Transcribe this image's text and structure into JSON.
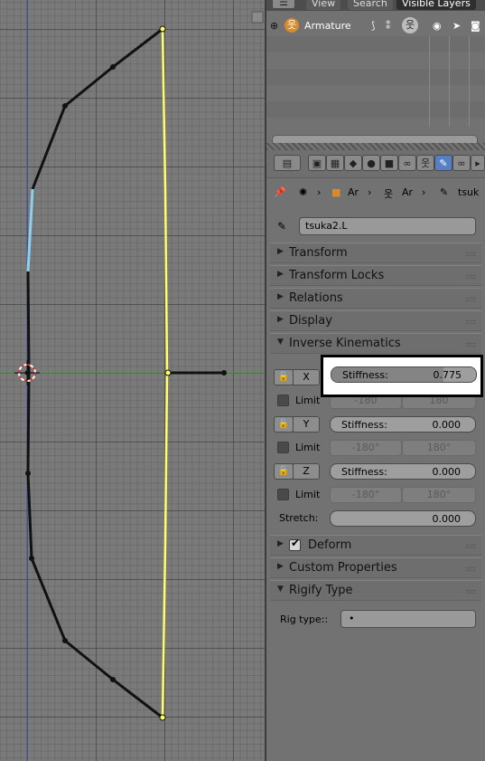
{
  "header": {
    "tabs": [
      "View",
      "Search",
      "Visible Layers"
    ],
    "active_tab": "Visible Layers"
  },
  "outliner": {
    "item_label": "Armature"
  },
  "breadcrumb": {
    "object": "Ar",
    "armature": "Ar",
    "bone": "tsuk"
  },
  "bone_name": "tsuka2.L",
  "panels": {
    "transform": "Transform",
    "transform_locks": "Transform Locks",
    "relations": "Relations",
    "display": "Display",
    "inverse_kinematics": "Inverse Kinematics",
    "deform": "Deform",
    "custom_properties": "Custom Properties",
    "rigify_type": "Rigify Type"
  },
  "ik": {
    "x": {
      "axis": "X",
      "stiffness_label": "Stiffness:",
      "stiffness": "0.775",
      "stiffness_fraction": 0.775,
      "limit_label": "Limit",
      "min": "-180",
      "max": "180"
    },
    "y": {
      "axis": "Y",
      "stiffness_label": "Stiffness:",
      "stiffness": "0.000",
      "stiffness_fraction": 0,
      "limit_label": "Limit",
      "min": "-180°",
      "max": "180°"
    },
    "z": {
      "axis": "Z",
      "stiffness_label": "Stiffness:",
      "stiffness": "0.000",
      "stiffness_fraction": 0,
      "limit_label": "Limit",
      "min": "-180°",
      "max": "180°"
    },
    "stretch_label": "Stretch:",
    "stretch": "0.000"
  },
  "rigify": {
    "rig_type_label": "Rig type::",
    "rig_type_value": "•"
  },
  "colors": {
    "selected_bone": "#ffff66",
    "active_bone": "#8ed0e8",
    "active_tab": "#5680c2",
    "highlight_box": "#000000"
  }
}
